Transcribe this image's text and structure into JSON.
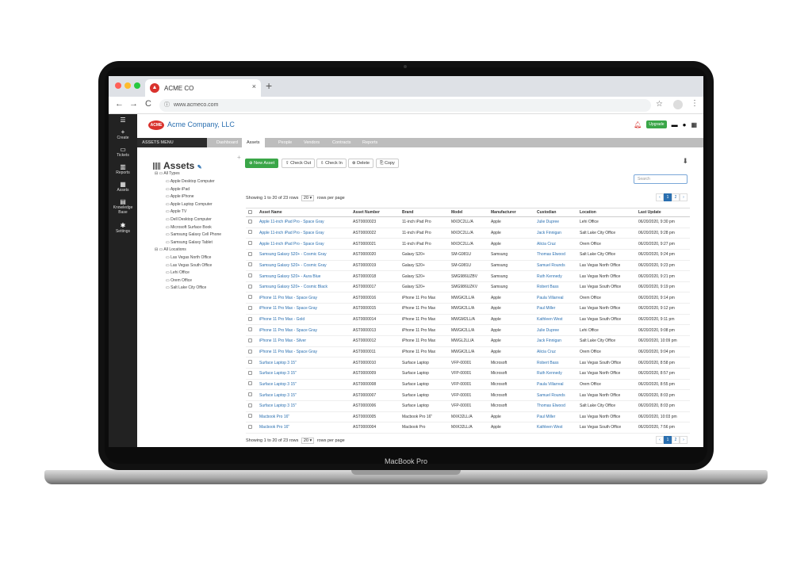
{
  "device": {
    "label": "MacBook Pro"
  },
  "browser": {
    "tab_title": "ACME CO",
    "url": "www.acmeco.com",
    "back": "←",
    "forward": "→",
    "reload": "C",
    "close": "×",
    "new_tab": "+",
    "bookmark": "☆",
    "menu": "⋮"
  },
  "sidebar": {
    "items": [
      {
        "label": "Create",
        "icon": "plus-icon"
      },
      {
        "label": "Tickets",
        "icon": "ticket-icon"
      },
      {
        "label": "Reports",
        "icon": "chart-icon"
      },
      {
        "label": "Assets",
        "icon": "barcode-icon"
      },
      {
        "label": "Knowledge Base",
        "icon": "book-icon"
      },
      {
        "label": "Settings",
        "icon": "gear-icon"
      }
    ]
  },
  "header": {
    "logo_text": "ACME",
    "company_name": "Acme Company, LLC",
    "upgrade_label": "Upgrade"
  },
  "menubar": {
    "assets_menu": "ASSETS MENU",
    "items": [
      "Dashboard",
      "Assets",
      "People",
      "Vendors",
      "Contracts",
      "Reports"
    ],
    "active": "Assets"
  },
  "tree": {
    "title": "Assets",
    "types_label": "All Types",
    "types": [
      "Apple Desktop Computer",
      "Apple iPad",
      "Apple iPhone",
      "Apple Laptop Computer",
      "Apple TV",
      "Dell Desktop Computer",
      "Microsoft Surface Book",
      "Samsung Galaxy Cell Phone",
      "Samsung Galaxy Tablet"
    ],
    "locations_label": "All Locations",
    "locations": [
      "Las Vegas North Office",
      "Las Vegas South Office",
      "Lehi Office",
      "Orem Office",
      "Salt Lake City Office"
    ]
  },
  "toolbar": {
    "new_asset": "New Asset",
    "check_out": "Check Out",
    "check_in": "Check In",
    "delete": "Delete",
    "copy": "Copy",
    "search_placeholder": "Search"
  },
  "pagination": {
    "showing_top": "Showing 1 to 20 of 23 rows",
    "showing_bottom": "Showing 1 to 20 of 23 rows",
    "page_size": "20",
    "rows_per_page": "rows per page",
    "prev": "‹",
    "pages": [
      "1",
      "2"
    ],
    "next": "›"
  },
  "table": {
    "columns": [
      "Asset Name",
      "Asset Number",
      "Brand",
      "Model",
      "Manufacturer",
      "Custodian",
      "Location",
      "Last Update"
    ],
    "rows": [
      [
        "Apple 11-inch iPad Pro - Space Gray",
        "AST0000023",
        "11-inch iPad Pro",
        "MXDC2LL/A",
        "Apple",
        "Julie Dupree",
        "Lehi Office",
        "06/20/2020, 9:30 pm"
      ],
      [
        "Apple 11-inch iPad Pro - Space Gray",
        "AST0000022",
        "11-inch iPad Pro",
        "MXDC2LL/A",
        "Apple",
        "Jack Finnigan",
        "Salt Lake City Office",
        "06/20/2020, 9:28 pm"
      ],
      [
        "Apple 11-inch iPad Pro - Space Gray",
        "AST0000021",
        "11-inch iPad Pro",
        "MXDC2LL/A",
        "Apple",
        "Alicia Cruz",
        "Orem Office",
        "06/20/2020, 9:27 pm"
      ],
      [
        "Samsung Galaxy S20+ - Cosmic Gray",
        "AST0000020",
        "Galaxy S20+",
        "SM-G981U",
        "Samsung",
        "Thomas Elwood",
        "Salt Lake City Office",
        "06/20/2020, 9:24 pm"
      ],
      [
        "Samsung Galaxy S20+ - Cosmic Gray",
        "AST0000019",
        "Galaxy S20+",
        "SM-G981U",
        "Samsung",
        "Samuel Rounds",
        "Las Vegas North Office",
        "06/20/2020, 9:23 pm"
      ],
      [
        "Samsung Galaxy S20+ - Aura Blue",
        "AST0000018",
        "Galaxy S20+",
        "SMG986UZBV",
        "Samsung",
        "Ruth Kennedy",
        "Las Vegas North Office",
        "06/20/2020, 9:21 pm"
      ],
      [
        "Samsung Galaxy S20+ - Cosmic Black",
        "AST0000017",
        "Galaxy S20+",
        "SMG986UZKV",
        "Samsung",
        "Robert Bass",
        "Las Vegas South Office",
        "06/20/2020, 9:19 pm"
      ],
      [
        "iPhone 11 Pro Max - Space Gray",
        "AST0000016",
        "iPhone 11 Pro Max",
        "MWGK2LL/A",
        "Apple",
        "Paula Villarreal",
        "Orem Office",
        "06/20/2020, 9:14 pm"
      ],
      [
        "iPhone 11 Pro Max - Space Gray",
        "AST0000015",
        "iPhone 11 Pro Max",
        "MWGK2LL/A",
        "Apple",
        "Paul Miller",
        "Las Vegas North Office",
        "06/20/2020, 9:12 pm"
      ],
      [
        "iPhone 11 Pro Max - Gold",
        "AST0000014",
        "iPhone 11 Pro Max",
        "MWGM2LL/A",
        "Apple",
        "Kathleen West",
        "Las Vegas South Office",
        "06/20/2020, 9:11 pm"
      ],
      [
        "iPhone 11 Pro Max - Space Gray",
        "AST0000013",
        "iPhone 11 Pro Max",
        "MWGK2LL/A",
        "Apple",
        "Julie Dupree",
        "Lehi Office",
        "06/20/2020, 9:08 pm"
      ],
      [
        "iPhone 11 Pro Max - Silver",
        "AST0000012",
        "iPhone 11 Pro Max",
        "MWGL2LL/A",
        "Apple",
        "Jack Finnigan",
        "Salt Lake City Office",
        "06/20/2020, 10:09 pm"
      ],
      [
        "iPhone 11 Pro Max - Space Gray",
        "AST0000011",
        "iPhone 11 Pro Max",
        "MWGK2LL/A",
        "Apple",
        "Alicia Cruz",
        "Orem Office",
        "06/20/2020, 9:04 pm"
      ],
      [
        "Surface Laptop 3 15\"",
        "AST0000010",
        "Surface Laptop",
        "VFP-00001",
        "Microsoft",
        "Robert Bass",
        "Las Vegas South Office",
        "06/20/2020, 8:58 pm"
      ],
      [
        "Surface Laptop 3 15\"",
        "AST0000009",
        "Surface Laptop",
        "VFP-00001",
        "Microsoft",
        "Ruth Kennedy",
        "Las Vegas North Office",
        "06/20/2020, 8:57 pm"
      ],
      [
        "Surface Laptop 3 15\"",
        "AST0000008",
        "Surface Laptop",
        "VFP-00001",
        "Microsoft",
        "Paula Villarreal",
        "Orem Office",
        "06/20/2020, 8:55 pm"
      ],
      [
        "Surface Laptop 3 15\"",
        "AST0000007",
        "Surface Laptop",
        "VFP-00001",
        "Microsoft",
        "Samuel Rounds",
        "Las Vegas North Office",
        "06/20/2020, 8:03 pm"
      ],
      [
        "Surface Laptop 3 15\"",
        "AST0000006",
        "Surface Laptop",
        "VFP-00001",
        "Microsoft",
        "Thomas Elwood",
        "Salt Lake City Office",
        "06/20/2020, 8:03 pm"
      ],
      [
        "Macbook Pro 16\"",
        "AST0000005",
        "Macbook Pro 16\"",
        "MXK32LL/A",
        "Apple",
        "Paul Miller",
        "Las Vegas North Office",
        "06/20/2020, 10:03 pm"
      ],
      [
        "Macbook Pro 16\"",
        "AST0000004",
        "Macbook Pro",
        "MXK32LL/A",
        "Apple",
        "Kathleen West",
        "Las Vegas South Office",
        "06/20/2020, 7:56 pm"
      ]
    ]
  },
  "colors": {
    "accent": "#2a6fb0",
    "brand": "#d9322d",
    "success": "#3aa648"
  }
}
